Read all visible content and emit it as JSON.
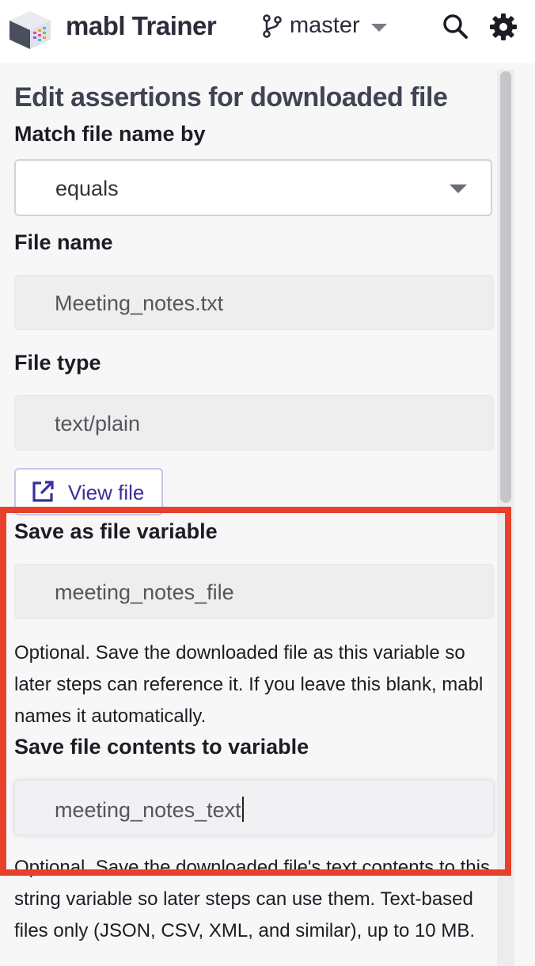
{
  "header": {
    "app_title": "mabl Trainer",
    "branch_label": "master",
    "logo_icon": "mabl-logo-icon",
    "branch_icon": "git-branch-icon",
    "search_icon": "search-icon",
    "settings_icon": "gear-icon"
  },
  "panel": {
    "title": "Edit assertions for downloaded file",
    "match_label": "Match file name by",
    "match_value": "equals",
    "file_name_label": "File name",
    "file_name_value": "Meeting_notes.txt",
    "file_type_label": "File type",
    "file_type_value": "text/plain",
    "view_file_label": "View file",
    "view_file_icon": "external-link-icon",
    "save_file_label": "Save as file variable",
    "save_file_value": "meeting_notes_file",
    "save_file_help": "Optional. Save the downloaded file as this variable so later steps can reference it. If you leave this blank, mabl names it automatically.",
    "save_contents_label": "Save file contents to variable",
    "save_contents_value": "meeting_notes_text",
    "save_contents_help": "Optional. Save the downloaded file's text contents to this string variable so later steps can use them. Text-based files only (JSON, CSV, XML, and similar), up to 10 MB."
  },
  "colors": {
    "highlight": "#e8402a",
    "accent": "#3a2f9c"
  }
}
